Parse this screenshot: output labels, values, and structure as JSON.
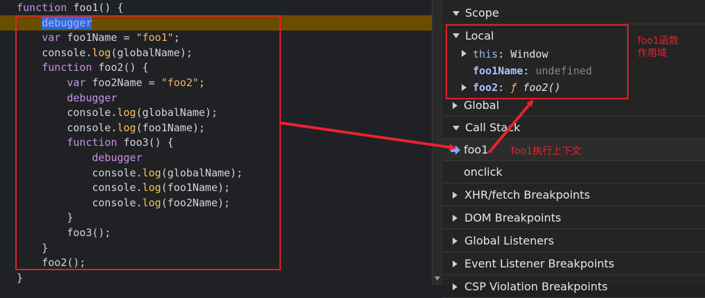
{
  "code": {
    "lines": [
      {
        "text": "function foo1() {"
      },
      {
        "indent": "    ",
        "text": "debugger"
      },
      {
        "indent": "    ",
        "kw": "var",
        "text": " foo1Name = ",
        "str": "\"foo1\"",
        "tail": ";"
      },
      {
        "indent": "    ",
        "obj": "console.",
        "call": "log",
        "text": "(globalName);"
      },
      {
        "indent": "    ",
        "kw": "function",
        "text": " foo2() {"
      },
      {
        "indent": "        ",
        "kw": "var",
        "text": " foo2Name = ",
        "str": "\"foo2\"",
        "tail": ";"
      },
      {
        "indent": "        ",
        "kw": "debugger",
        "text": ""
      },
      {
        "indent": "        ",
        "obj": "console.",
        "call": "log",
        "text": "(globalName);"
      },
      {
        "indent": "        ",
        "obj": "console.",
        "call": "log",
        "text": "(foo1Name);"
      },
      {
        "indent": "        ",
        "kw": "function",
        "text": " foo3() {"
      },
      {
        "indent": "            ",
        "kw": "debugger",
        "text": ""
      },
      {
        "indent": "            ",
        "obj": "console.",
        "call": "log",
        "text": "(globalName);"
      },
      {
        "indent": "            ",
        "obj": "console.",
        "call": "log",
        "text": "(foo1Name);"
      },
      {
        "indent": "            ",
        "obj": "console.",
        "call": "log",
        "text": "(foo2Name);"
      },
      {
        "indent": "        ",
        "text": "}"
      },
      {
        "indent": "        ",
        "text": "foo3();"
      },
      {
        "indent": "    ",
        "text": "}"
      },
      {
        "indent": "    ",
        "text": "foo2();"
      },
      {
        "text": "}"
      }
    ]
  },
  "panel": {
    "scope_title": "Scope",
    "local_title": "Local",
    "this_key": "this",
    "this_value": "Window",
    "foo1name_key": "foo1Name",
    "foo1name_value": "undefined",
    "foo2_key": "foo2",
    "foo2_f": "ƒ",
    "foo2_value": "foo2()",
    "global_title": "Global",
    "callstack_title": "Call Stack",
    "frames": [
      "foo1",
      "onclick"
    ],
    "sections": [
      "XHR/fetch Breakpoints",
      "DOM Breakpoints",
      "Global Listeners",
      "Event Listener Breakpoints",
      "CSP Violation Breakpoints"
    ]
  },
  "annotations": {
    "scope_note": "foo1函数\n作用域",
    "context_note": "foo1执行上下文"
  },
  "colors": {
    "annotation_red": "#e0202a",
    "keyword": "#c792ea",
    "string": "#f2b36b",
    "paused_line": "#6b4d00"
  }
}
